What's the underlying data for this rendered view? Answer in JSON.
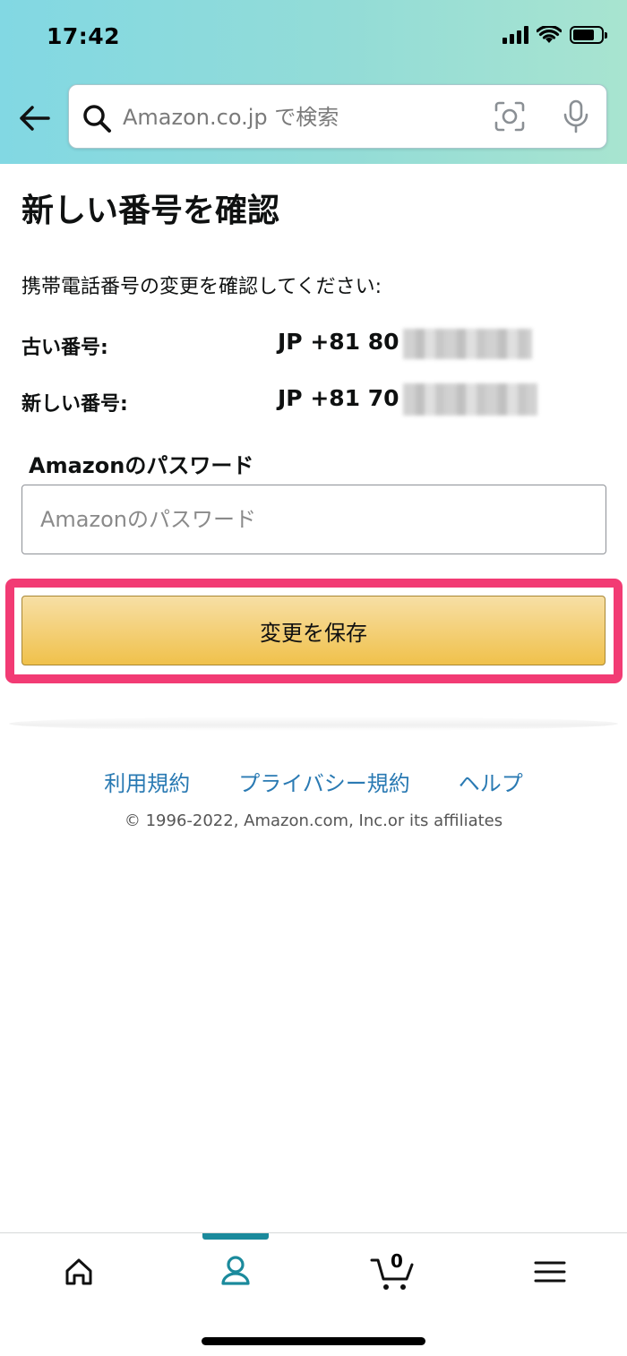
{
  "status_bar": {
    "time": "17:42"
  },
  "header": {
    "search_placeholder": "Amazon.co.jp で検索"
  },
  "main": {
    "title": "新しい番号を確認",
    "instruction": "携帯電話番号の変更を確認してください:",
    "old_number": {
      "label": "古い番号:",
      "value": "JP +81 80"
    },
    "new_number": {
      "label": "新しい番号:",
      "value": "JP +81 70"
    },
    "password": {
      "label": "Amazonのパスワード",
      "placeholder": "Amazonのパスワード",
      "value": ""
    },
    "save_button": "変更を保存",
    "highlight_color": "#f23b74",
    "button_color": "#f0c14b"
  },
  "footer": {
    "links": [
      "利用規約",
      "プライバシー規約",
      "ヘルプ"
    ],
    "copyright": "© 1996-2022, Amazon.com, Inc.or its affiliates",
    "link_color": "#2a7ab3"
  },
  "bottom_nav": {
    "items": [
      {
        "name": "home",
        "icon": "home-icon"
      },
      {
        "name": "account",
        "icon": "user-icon",
        "active": true
      },
      {
        "name": "cart",
        "icon": "cart-icon"
      },
      {
        "name": "menu",
        "icon": "hamburger-icon"
      }
    ],
    "cart_count": "0",
    "accent_color": "#1b8a9c"
  }
}
